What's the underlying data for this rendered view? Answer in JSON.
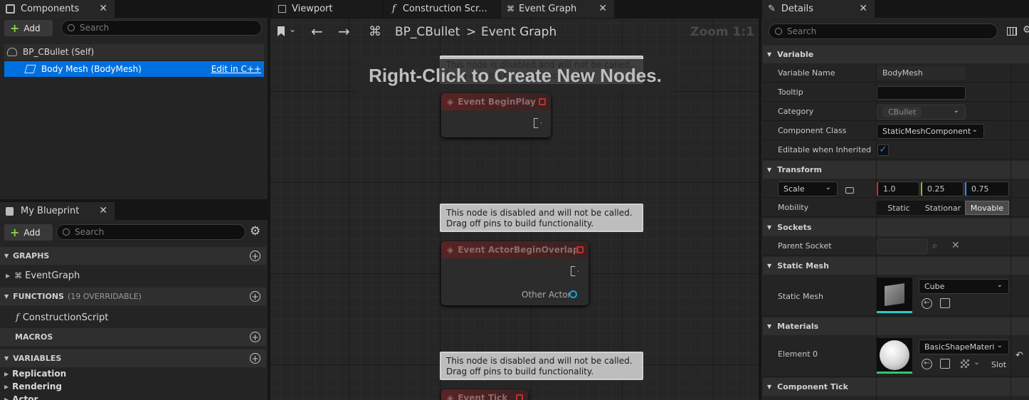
{
  "tabs": {
    "components": "Components",
    "viewport": "Viewport",
    "construction": "Construction Scr...",
    "event_graph": "Event Graph",
    "details": "Details",
    "my_blueprint": "My Blueprint"
  },
  "components": {
    "add_label": "Add",
    "search_placeholder": "Search",
    "items": [
      {
        "label": "BP_CBullet (Self)"
      },
      {
        "label": "Body Mesh (BodyMesh)",
        "action": "Edit in C++"
      }
    ]
  },
  "my_blueprint": {
    "add_label": "Add",
    "search_placeholder": "Search",
    "graphs_header": "GRAPHS",
    "event_graph": "EventGraph",
    "functions_header": "FUNCTIONS",
    "functions_count": "(19 OVERRIDABLE)",
    "construction_script": "ConstructionScript",
    "macros_header": "MACROS",
    "variables_header": "VARIABLES",
    "variable_categories": [
      "Replication",
      "Rendering",
      "Actor"
    ]
  },
  "graph": {
    "breadcrumb_root": "BP_CBullet",
    "breadcrumb_sep": ">",
    "breadcrumb_current": "Event Graph",
    "zoom": "Zoom 1:1",
    "hint": "Right-Click to Create New Nodes.",
    "disabled_line1": "This node is disabled and will not be called.",
    "disabled_line2": "Drag off pins to build functionality.",
    "node_begin_play": "Event BeginPlay",
    "node_overlap": "Event ActorBeginOverlap",
    "pin_other_actor": "Other Actor",
    "node_tick": "Event Tick"
  },
  "details": {
    "search_placeholder": "Search",
    "variable_section": "Variable",
    "variable_name_label": "Variable Name",
    "variable_name_value": "BodyMesh",
    "tooltip_label": "Tooltip",
    "tooltip_value": "",
    "category_label": "Category",
    "category_value": "CBullet",
    "component_class_label": "Component Class",
    "component_class_value": "StaticMeshComponent",
    "editable_label": "Editable when Inherited",
    "editable_checked": true,
    "transform_section": "Transform",
    "scale_label": "Scale",
    "scale_x": "1.0",
    "scale_y": "0.25",
    "scale_z": "0.75",
    "mobility_label": "Mobility",
    "mobility_options": [
      "Static",
      "Stationar",
      "Movable"
    ],
    "mobility_selected": "Movable",
    "sockets_section": "Sockets",
    "parent_socket_label": "Parent Socket",
    "static_mesh_section": "Static Mesh",
    "static_mesh_label": "Static Mesh",
    "static_mesh_value": "Cube",
    "materials_section": "Materials",
    "element0_label": "Element 0",
    "element0_value": "BasicShapeMateri",
    "slot_label": "Slot",
    "component_tick_section": "Component Tick"
  },
  "colors": {
    "selection": "#0070e0",
    "add_plus": "#7fd44a",
    "disabled_node_red": "#c03030"
  }
}
